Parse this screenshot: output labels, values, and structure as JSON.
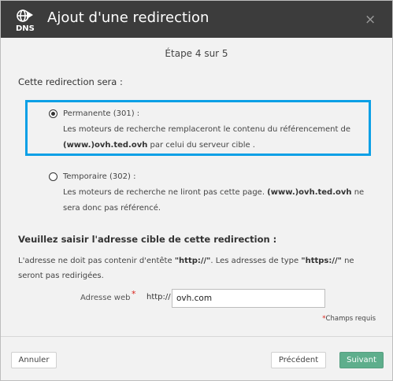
{
  "header": {
    "title": "Ajout d'une redirection",
    "logo_text": "DNS",
    "close_symbol": "×"
  },
  "step": "Étape 4 sur 5",
  "redirect_type": {
    "label": "Cette redirection sera :",
    "options": [
      {
        "title": "Permanente (301) :",
        "desc_before": "Les moteurs de recherche remplaceront le contenu du référencement de ",
        "host": "(www.)ovh.ted.ovh",
        "desc_after": " par celui du serveur cible .",
        "checked": true
      },
      {
        "title": "Temporaire (302) :",
        "desc_before": "Les moteurs de recherche ne liront pas cette page. ",
        "host": "(www.)ovh.ted.ovh",
        "desc_after": " ne sera donc pas référencé.",
        "checked": false
      }
    ]
  },
  "target": {
    "heading": "Veuillez saisir l'adresse cible de cette redirection :",
    "hint_1": "L'adresse ne doit pas contenir d'entête ",
    "hint_http": "\"http://\"",
    "hint_2": ". Les adresses de type ",
    "hint_https": "\"https://\"",
    "hint_3": " ne seront pas redirigées.",
    "field_label": "Adresse web",
    "required_mark": "*",
    "prefix": "http://",
    "value": "ovh.com",
    "required_note_mark": "*",
    "required_note": "Champs requis"
  },
  "buttons": {
    "cancel": "Annuler",
    "previous": "Précédent",
    "next": "Suivant"
  },
  "colors": {
    "header_bg": "#3c3c3c",
    "selection_border": "#0ba0e6",
    "next_button": "#5eae8c",
    "required": "#d9241c"
  }
}
